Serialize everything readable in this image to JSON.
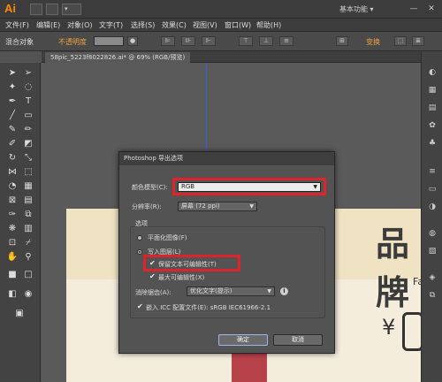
{
  "titlebar": {
    "logo": "Ai",
    "doc_switch_box": "",
    "arrange_label": "▾",
    "workspace": "基本功能",
    "workspace_caret": "▾",
    "minimize": "—",
    "close": "✕"
  },
  "menu": [
    "文件(F)",
    "编辑(E)",
    "对象(O)",
    "文字(T)",
    "选择(S)",
    "效果(C)",
    "视图(V)",
    "窗口(W)",
    "帮助(H)"
  ],
  "controlbar": {
    "selection": "混合对象",
    "opacity_label": "不透明度",
    "transform": "变换"
  },
  "doc_tab": "58pic_5223f8022826.ai* @ 69% (RGB/预览)",
  "artwork": {
    "brand": "品牌",
    "fashion": "Fash",
    "yen": "¥"
  },
  "dialog": {
    "title": "Photoshop 导出选项",
    "color_model_label": "颜色模型(C):",
    "color_model_value": "RGB",
    "resolution_label": "分辨率(R):",
    "resolution_value": "屏幕 (72 ppi)",
    "options_label": "选项",
    "flat_image": "平面化图像(F)",
    "write_layers": "写入图层(L)",
    "preserve_text": "保留文本可编辑性(T)",
    "max_editability": "最大可编辑性(X)",
    "antialias_label": "消除锯齿(A):",
    "antialias_value": "优化文字(提示)",
    "embed_icc": "嵌入 ICC 配置文件(E): sRGB IEC61966-2.1",
    "ok": "确定",
    "cancel": "取消"
  },
  "colors": {
    "highlight": "#e0222a",
    "app_bg": "#535353",
    "logo": "#ff8a00"
  },
  "icons": [
    "selection-tool-icon",
    "direct-selection-tool-icon",
    "pen-tool-icon",
    "type-tool-icon",
    "line-tool-icon",
    "rectangle-tool-icon",
    "brush-tool-icon",
    "pencil-tool-icon",
    "rotate-tool-icon",
    "scale-tool-icon",
    "eyedropper-tool-icon",
    "gradient-tool-icon",
    "zoom-tool-icon",
    "hand-tool-icon"
  ]
}
